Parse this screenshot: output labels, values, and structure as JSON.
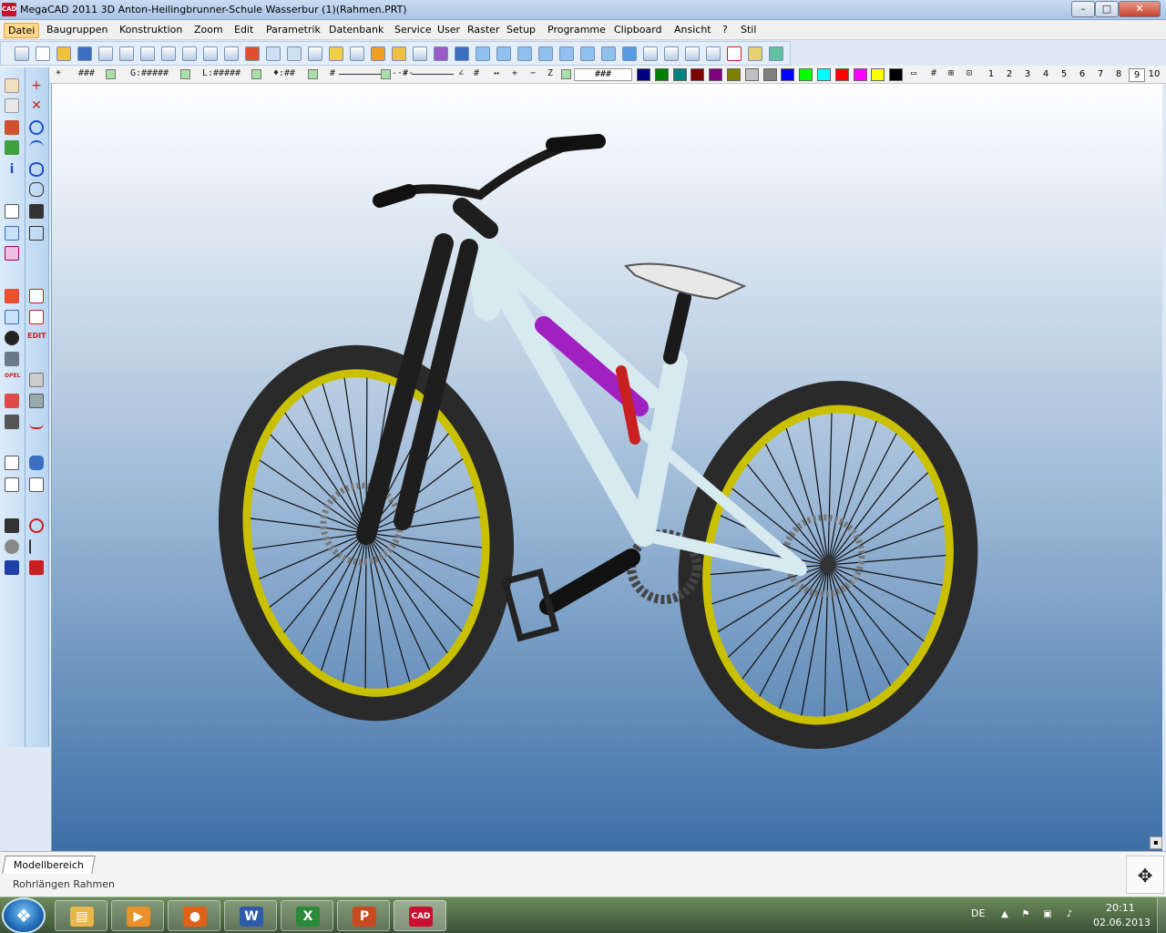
{
  "window": {
    "logo_text": "CAD",
    "title": "MegaCAD 2011 3D  Anton-Heilingbrunner-Schule Wasserbur (1)(Rahmen.PRT)",
    "minimize": "–",
    "maximize": "□",
    "close": "✕"
  },
  "menu": [
    "Datei",
    "Baugruppen",
    "Konstruktion",
    "Zoom",
    "Edit",
    "Parametrik",
    "Datenbank",
    "Service",
    "User",
    "Raster",
    "Setup",
    "Programme",
    "Clipboard",
    "Ansicht",
    "?",
    "Stil"
  ],
  "toolbar2": {
    "grid": "###",
    "g_field": "G:#####",
    "l_field": "L:#####",
    "w_field": "♦:##",
    "hash_a": "#",
    "hash_b": "#",
    "hash_c": "#",
    "color_field": "###",
    "layers": [
      "1",
      "2",
      "3",
      "4",
      "5",
      "6",
      "7",
      "8",
      "9",
      "10"
    ],
    "selected_layer": "9"
  },
  "colors": {
    "palette": [
      "#000080",
      "#008000",
      "#008080",
      "#800000",
      "#800080",
      "#808000",
      "#c0c0c0",
      "#808080",
      "#0000ff",
      "#00ff00",
      "#00ffff",
      "#ff0000",
      "#ff00ff",
      "#ffff00",
      "#000000"
    ],
    "frame": "#d7eaf0",
    "tire": "#2a2a2a",
    "rim": "#c8c000",
    "shock": "#a020c0",
    "link": "#c82020",
    "fork": "#1e1e1e"
  },
  "sidebar_left": {
    "edit_label": "EDIT",
    "opel_label": "OPEL"
  },
  "layout_tabs": {
    "model": "Modellbereich",
    "rohr": "Rohrlängen Rahmen"
  },
  "canvas": {
    "corner": "▪"
  },
  "taskbar": {
    "apps": [
      {
        "name": "explorer",
        "glyph": "▤",
        "color": "#e8b84a"
      },
      {
        "name": "media-player",
        "glyph": "▶",
        "color": "#e8902a"
      },
      {
        "name": "firefox",
        "glyph": "●",
        "color": "#e06018"
      },
      {
        "name": "word",
        "glyph": "W",
        "color": "#2f5aa8"
      },
      {
        "name": "excel",
        "glyph": "X",
        "color": "#2a8a3a"
      },
      {
        "name": "powerpoint",
        "glyph": "P",
        "color": "#c84a20"
      },
      {
        "name": "megacad",
        "glyph": "CAD",
        "color": "#c8102e"
      }
    ],
    "lang": "DE",
    "time": "20:11",
    "date": "02.06.2013"
  }
}
